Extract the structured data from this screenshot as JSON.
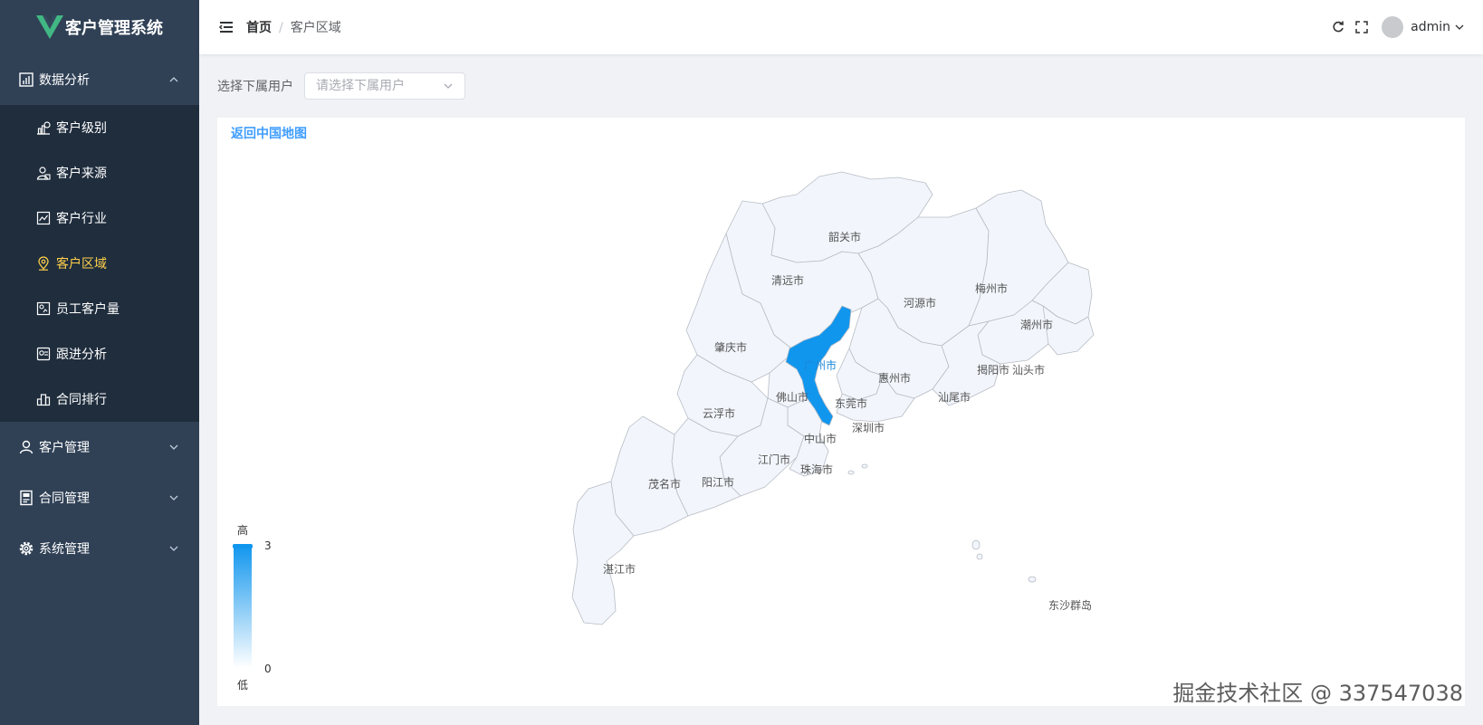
{
  "app": {
    "title": "客户管理系统",
    "logo_letter": "V",
    "logo_color": "#41b883"
  },
  "sidebar": {
    "groups": [
      {
        "label": "数据分析",
        "icon": "chart-analysis-icon",
        "expanded": true
      },
      {
        "label": "客户管理",
        "icon": "user-icon",
        "expanded": false
      },
      {
        "label": "合同管理",
        "icon": "contract-icon",
        "expanded": false
      },
      {
        "label": "系统管理",
        "icon": "gear-icon",
        "expanded": false
      }
    ],
    "analysis_items": [
      {
        "label": "客户级别",
        "icon": "bar-chart-icon",
        "active": false
      },
      {
        "label": "客户来源",
        "icon": "user-source-icon",
        "active": false
      },
      {
        "label": "客户行业",
        "icon": "industry-icon",
        "active": false
      },
      {
        "label": "客户区域",
        "icon": "location-icon",
        "active": true
      },
      {
        "label": "员工客户量",
        "icon": "employee-stats-icon",
        "active": false
      },
      {
        "label": "跟进分析",
        "icon": "follow-up-icon",
        "active": false
      },
      {
        "label": "合同排行",
        "icon": "ranking-icon",
        "active": false
      }
    ],
    "bg_color": "#304156",
    "submenu_bg": "#1f2d3d",
    "active_color": "#ffd04b"
  },
  "header": {
    "breadcrumb": {
      "home": "首页",
      "separator": "/",
      "current": "客户区域"
    },
    "username": "admin"
  },
  "filter": {
    "label": "选择下属用户",
    "placeholder": "请选择下属用户"
  },
  "map": {
    "back_label": "返回中国地图",
    "cities": [
      {
        "name": "韶关市",
        "value": 0
      },
      {
        "name": "清远市",
        "value": 0
      },
      {
        "name": "河源市",
        "value": 0
      },
      {
        "name": "梅州市",
        "value": 0
      },
      {
        "name": "潮州市",
        "value": 0
      },
      {
        "name": "肇庆市",
        "value": 0
      },
      {
        "name": "广州市",
        "value": 3
      },
      {
        "name": "惠州市",
        "value": 0
      },
      {
        "name": "揭阳市",
        "value": 0
      },
      {
        "name": "汕头市",
        "value": 0
      },
      {
        "name": "佛山市",
        "value": 0
      },
      {
        "name": "东莞市",
        "value": 0
      },
      {
        "name": "汕尾市",
        "value": 0
      },
      {
        "name": "云浮市",
        "value": 0
      },
      {
        "name": "深圳市",
        "value": 0
      },
      {
        "name": "中山市",
        "value": 0
      },
      {
        "name": "江门市",
        "value": 0
      },
      {
        "name": "珠海市",
        "value": 0
      },
      {
        "name": "茂名市",
        "value": 0
      },
      {
        "name": "阳江市",
        "value": 0
      },
      {
        "name": "湛江市",
        "value": 0
      },
      {
        "name": "东沙群岛",
        "value": 0
      }
    ],
    "visual_map": {
      "high_label": "高",
      "low_label": "低",
      "max": 3,
      "min": 0
    },
    "colors": {
      "highlight": "#1196ee",
      "base": "#f2f6fc",
      "border": "#b7bcc4"
    }
  },
  "watermark": "掘金技术社区 @ 337547038"
}
